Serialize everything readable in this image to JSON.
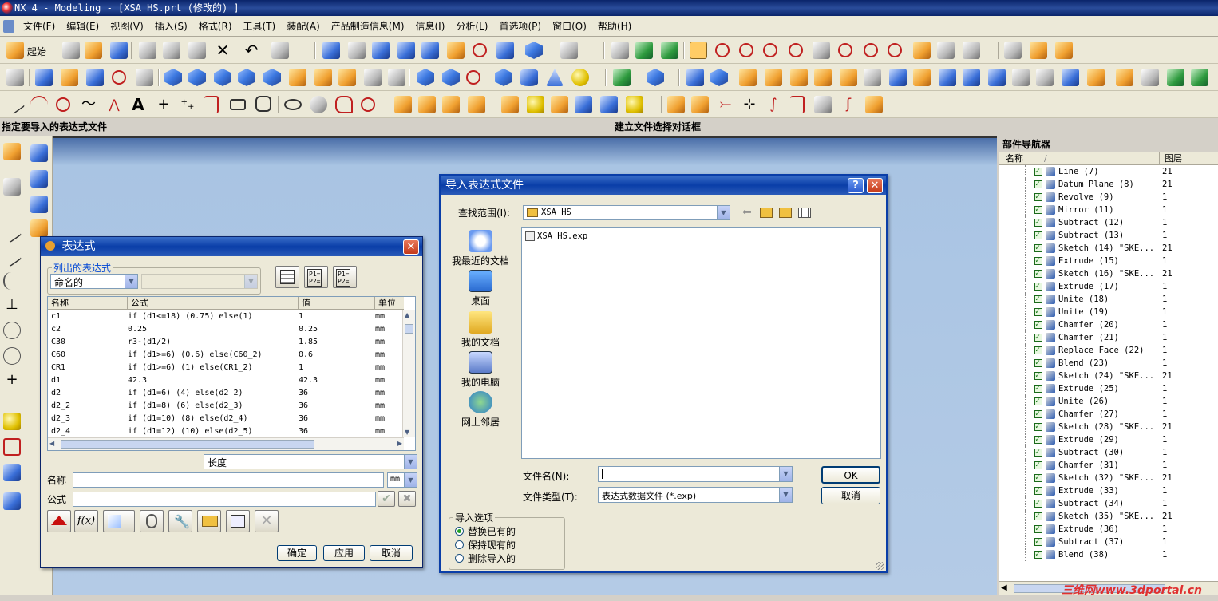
{
  "window": {
    "title": "NX 4 - Modeling - [XSA HS.prt  (修改的) ]"
  },
  "menu": [
    "文件(F)",
    "编辑(E)",
    "视图(V)",
    "插入(S)",
    "格式(R)",
    "工具(T)",
    "装配(A)",
    "产品制造信息(M)",
    "信息(I)",
    "分析(L)",
    "首选项(P)",
    "窗口(O)",
    "帮助(H)"
  ],
  "toolbar": {
    "start_label": "起始"
  },
  "cue": {
    "left": "指定要导入的表达式文件",
    "right": "建立文件选择对话框"
  },
  "navigator": {
    "title": "部件导航器",
    "col_name": "名称",
    "col_layer": "图层",
    "rows": [
      {
        "name": "Line (7)",
        "layer": "21"
      },
      {
        "name": "Datum Plane (8)",
        "layer": "21"
      },
      {
        "name": "Revolve (9)",
        "layer": "1"
      },
      {
        "name": "Mirror (11)",
        "layer": "1"
      },
      {
        "name": "Subtract (12)",
        "layer": "1"
      },
      {
        "name": "Subtract (13)",
        "layer": "1"
      },
      {
        "name": "Sketch (14) \"SKE...",
        "layer": "21"
      },
      {
        "name": "Extrude (15)",
        "layer": "1"
      },
      {
        "name": "Sketch (16) \"SKE...",
        "layer": "21"
      },
      {
        "name": "Extrude (17)",
        "layer": "1"
      },
      {
        "name": "Unite (18)",
        "layer": "1"
      },
      {
        "name": "Unite (19)",
        "layer": "1"
      },
      {
        "name": "Chamfer (20)",
        "layer": "1"
      },
      {
        "name": "Chamfer (21)",
        "layer": "1"
      },
      {
        "name": "Replace Face (22)",
        "layer": "1"
      },
      {
        "name": "Blend (23)",
        "layer": "1"
      },
      {
        "name": "Sketch (24) \"SKE...",
        "layer": "21"
      },
      {
        "name": "Extrude (25)",
        "layer": "1"
      },
      {
        "name": "Unite (26)",
        "layer": "1"
      },
      {
        "name": "Chamfer (27)",
        "layer": "1"
      },
      {
        "name": "Sketch (28) \"SKE...",
        "layer": "21"
      },
      {
        "name": "Extrude (29)",
        "layer": "1"
      },
      {
        "name": "Subtract (30)",
        "layer": "1"
      },
      {
        "name": "Chamfer (31)",
        "layer": "1"
      },
      {
        "name": "Sketch (32) \"SKE...",
        "layer": "21"
      },
      {
        "name": "Extrude (33)",
        "layer": "1"
      },
      {
        "name": "Subtract (34)",
        "layer": "1"
      },
      {
        "name": "Sketch (35) \"SKE...",
        "layer": "21"
      },
      {
        "name": "Extrude (36)",
        "layer": "1"
      },
      {
        "name": "Subtract (37)",
        "layer": "1"
      },
      {
        "name": "Blend (38)",
        "layer": "1"
      }
    ]
  },
  "expr_dialog": {
    "title": "表达式",
    "group_label": "列出的表达式",
    "filter_value": "命名的",
    "cols": {
      "name": "名称",
      "formula": "公式",
      "value": "值",
      "unit": "单位"
    },
    "rows": [
      {
        "name": "c1",
        "formula": "if (d1<=18) (0.75) else(1)",
        "value": "1",
        "unit": "mm"
      },
      {
        "name": "c2",
        "formula": "0.25",
        "value": "0.25",
        "unit": "mm"
      },
      {
        "name": "C30",
        "formula": "r3-(d1/2)",
        "value": "1.85",
        "unit": "mm"
      },
      {
        "name": "C60",
        "formula": "if (d1>=6) (0.6) else(C60_2)",
        "value": "0.6",
        "unit": "mm"
      },
      {
        "name": "CR1",
        "formula": "if (d1>=6) (1) else(CR1_2)",
        "value": "1",
        "unit": "mm"
      },
      {
        "name": "d1",
        "formula": "42.3",
        "value": "42.3",
        "unit": "mm"
      },
      {
        "name": "d2",
        "formula": "if (d1=6) (4) else(d2_2)",
        "value": "36",
        "unit": "mm"
      },
      {
        "name": "d2_2",
        "formula": "if (d1=8) (6) else(d2_3)",
        "value": "36",
        "unit": "mm"
      },
      {
        "name": "d2_3",
        "formula": "if (d1=10) (8) else(d2_4)",
        "value": "36",
        "unit": "mm"
      },
      {
        "name": "d2_4",
        "formula": "if (d1=12) (10) else(d2_5)",
        "value": "36",
        "unit": "mm"
      }
    ],
    "type_value": "长度",
    "name_label": "名称",
    "unit_value": "mm",
    "formula_label": "公式",
    "ok": "确定",
    "apply": "应用",
    "cancel": "取消"
  },
  "import_dialog": {
    "title": "导入表达式文件",
    "lookin_label": "查找范围(I):",
    "lookin_value": "XSA HS",
    "places": [
      "我最近的文档",
      "桌面",
      "我的文档",
      "我的电脑",
      "网上邻居"
    ],
    "files": [
      "XSA HS.exp"
    ],
    "filename_label": "文件名(N):",
    "filename_value": "",
    "filetype_label": "文件类型(T):",
    "filetype_value": "表达式数据文件 (*.exp)",
    "ok": "OK",
    "cancel": "取消",
    "options_title": "导入选项",
    "options": [
      "替换已有的",
      "保持现有的",
      "删除导入的"
    ],
    "selected_option": 0
  },
  "watermark": "三维网www.3dportal.cn",
  "colors": {
    "title_blue": "#0a246a",
    "graphics_bg": "#b4cbe6",
    "dialog_bg": "#ece9d8"
  }
}
